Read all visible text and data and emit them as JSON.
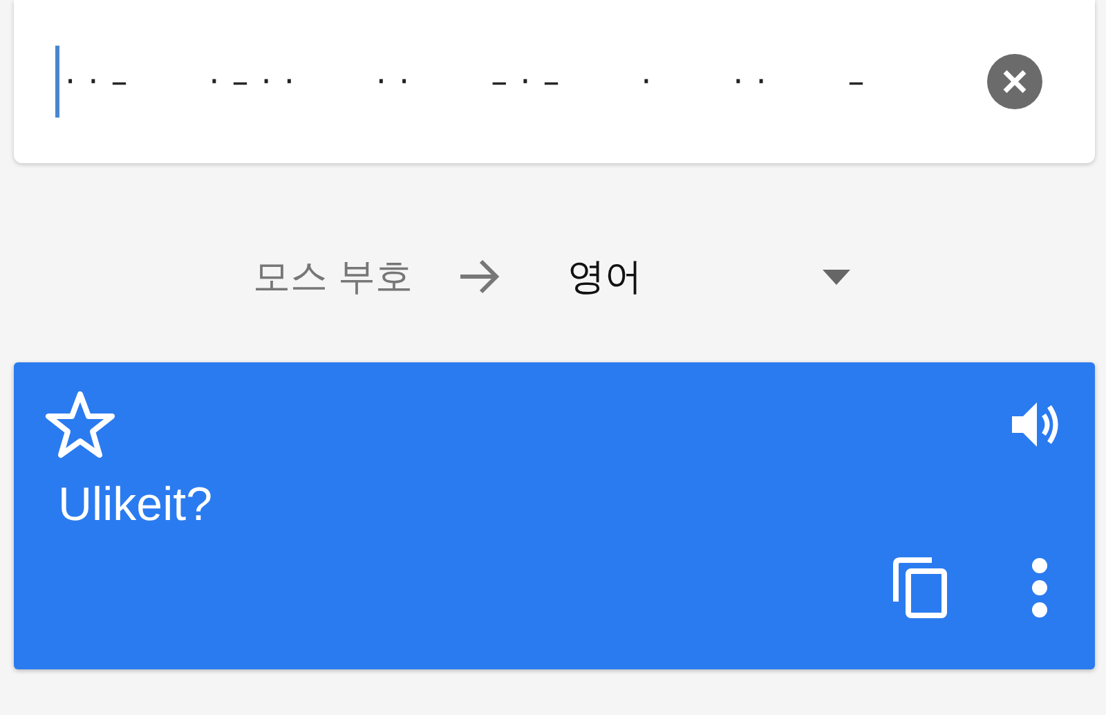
{
  "input": {
    "value": "··–   ·–··   ··   –·–   ·   ··   –"
  },
  "languages": {
    "source": "모스 부호",
    "target": "영어"
  },
  "result": {
    "text": "Ulikeit?",
    "starred": false
  }
}
